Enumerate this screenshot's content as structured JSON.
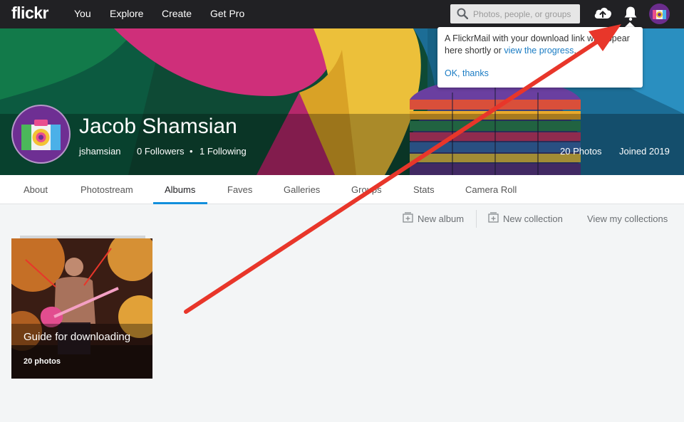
{
  "nav": {
    "logo": "flickr",
    "links": [
      "You",
      "Explore",
      "Create",
      "Get Pro"
    ],
    "search_placeholder": "Photos, people, or groups",
    "icons": [
      "search-icon",
      "upload-cloud-icon",
      "notification-bell-icon",
      "user-avatar"
    ]
  },
  "notification": {
    "message_start": "A FlickrMail with your download link will appear here shortly or ",
    "message_link": "view the progress",
    "message_end": ".",
    "action": "OK, thanks"
  },
  "profile": {
    "name": "Jacob Shamsian",
    "username": "jshamsian",
    "followers": "0 Followers",
    "following": "1 Following",
    "photos": "20 Photos",
    "joined": "Joined 2019"
  },
  "tabs": {
    "items": [
      "About",
      "Photostream",
      "Albums",
      "Faves",
      "Galleries",
      "Groups",
      "Stats",
      "Camera Roll"
    ],
    "active": "Albums"
  },
  "toolbar": {
    "new_album": "New album",
    "new_collection": "New collection",
    "view_collections": "View my collections"
  },
  "albums": [
    {
      "title": "Guide for downloading",
      "count": "20 photos"
    }
  ],
  "colors": {
    "nav_bg": "#212124",
    "accent": "#128fdc",
    "link": "#1a7cc4",
    "annotation_arrow": "#e8362a",
    "page_bg": "#f3f5f6"
  }
}
